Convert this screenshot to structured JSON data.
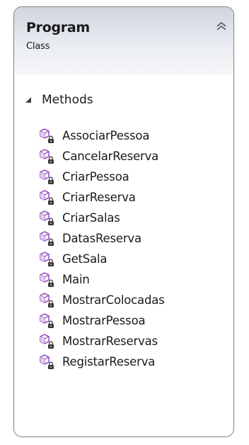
{
  "class_shape": {
    "name": "Program",
    "stereotype": "Class",
    "collapse_icon": "double-chevron-up-icon",
    "compartment": {
      "label": "Methods",
      "expand_icon": "triangle-expanded-icon",
      "method_icon": "private-method-icon",
      "methods": [
        "AssociarPessoa",
        "CancelarReserva",
        "CriarPessoa",
        "CriarReserva",
        "CriarSalas",
        "DatasReserva",
        "GetSala",
        "Main",
        "MostrarColocadas",
        "MostrarPessoa",
        "MostrarReservas",
        "RegistarReserva"
      ]
    }
  },
  "colors": {
    "method_icon": "#8b3fb8",
    "lock": "#3a3a3a",
    "border": "#7f7f7f",
    "header_top": "#d0d5df",
    "header_bottom": "#f7f8fa"
  }
}
